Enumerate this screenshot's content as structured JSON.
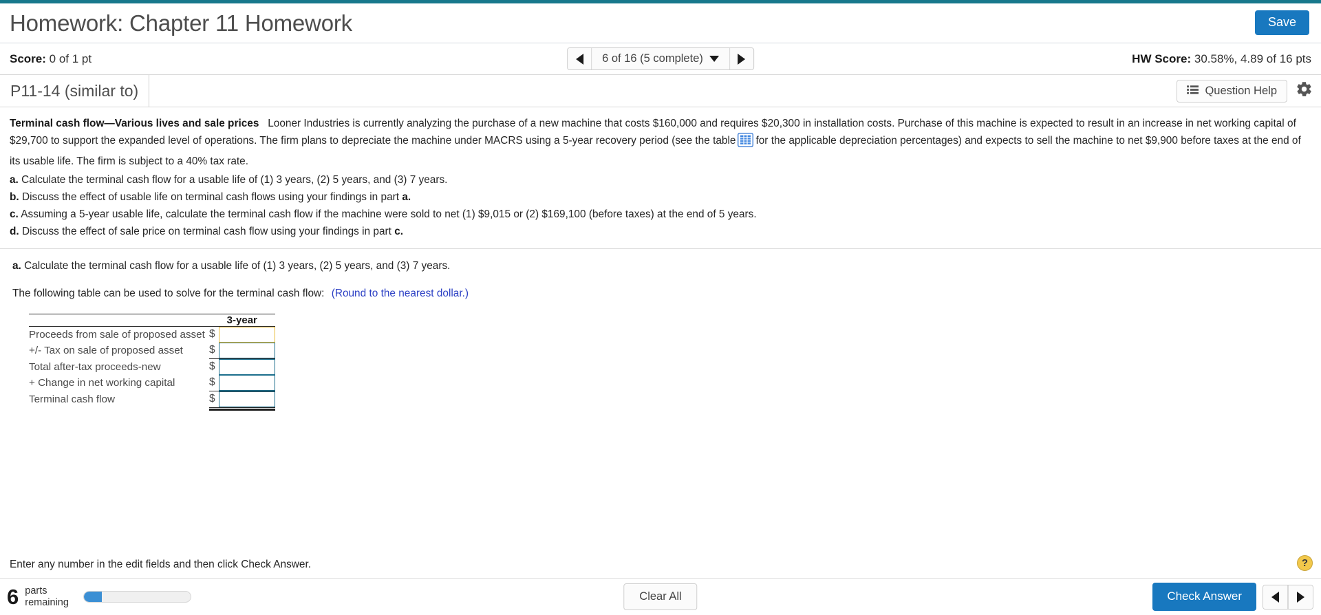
{
  "header": {
    "title": "Homework: Chapter 11 Homework",
    "save_label": "Save",
    "accent_color": "#17788c",
    "primary_button_color": "#1878bf"
  },
  "score_bar": {
    "score_label": "Score:",
    "score_value": "0 of 1 pt",
    "nav": {
      "position_text": "6 of 16 (5 complete)",
      "prev_icon": "triangle-left-icon",
      "next_icon": "triangle-right-icon",
      "dropdown_icon": "caret-down-icon"
    },
    "hw_score_label": "HW Score:",
    "hw_score_value": "30.58%, 4.89 of 16 pts"
  },
  "question_bar": {
    "question_id": "P11-14 (similar to)",
    "question_help_label": "Question Help",
    "question_help_icon": "list-icon",
    "settings_icon": "gear-icon"
  },
  "problem": {
    "title": "Terminal cash flow—Various lives and sale prices",
    "body_part_1": "Looner Industries is currently analyzing the purchase of a new machine that costs $160,000 and requires $20,300 in installation costs. Purchase of this machine is expected to result in an increase in net working capital of $29,700 to support the expanded level of operations. The firm plans to depreciate the machine under MACRS using a 5-year recovery period (see the table",
    "table_icon": "spreadsheet-table-icon",
    "body_part_2": "for the applicable depreciation percentages) and expects to sell the machine to net $9,900 before taxes at the end of its usable life. The firm is subject to a 40% tax rate.",
    "parts": [
      {
        "letter": "a.",
        "text": "Calculate the terminal cash flow for a usable life of  (1) 3 years, (2) 5 years, and (3) 7 years."
      },
      {
        "letter": "b.",
        "text": "Discuss the effect of usable life on terminal cash flows using your findings in part",
        "ref": "a."
      },
      {
        "letter": "c.",
        "text": " Assuming a 5-year usable life, calculate the terminal cash flow if the machine were sold to net (1) $9,015 or (2) $169,100 (before taxes) at the end of 5 years."
      },
      {
        "letter": "d.",
        "text": "Discuss the effect of sale price on terminal cash flow using your findings in part",
        "ref": "c."
      }
    ]
  },
  "subquestion": {
    "letter": "a.",
    "text": "Calculate the terminal cash flow for a usable life of  (1) 3 years, (2) 5 years, and (3) 7 years.",
    "prompt": "The following table can be used to solve for the terminal cash flow:",
    "round_note": "(Round to the nearest dollar.)",
    "round_note_color": "#2b3fc4"
  },
  "answer_table": {
    "column_header": "3-year",
    "currency_symbol": "$",
    "active_field_border": "#e8bb3c",
    "field_border": "#1c6e8c",
    "rows": [
      {
        "label": "Proceeds from sale of proposed asset",
        "value": "",
        "active": true
      },
      {
        "label": "+/- Tax on sale of proposed asset",
        "value": "",
        "active": false
      },
      {
        "label": "Total after-tax proceeds-new",
        "value": "",
        "active": false
      },
      {
        "label": "+ Change in net working capital",
        "value": "",
        "active": false
      },
      {
        "label": "Terminal cash flow",
        "value": "",
        "active": false
      }
    ]
  },
  "footer": {
    "message": "Enter any number in the edit fields and then click Check Answer.",
    "help_icon_label": "?",
    "parts_remaining_count": "6",
    "parts_remaining_line1": "parts",
    "parts_remaining_line2": "remaining",
    "progress_percent": 17,
    "clear_all_label": "Clear All",
    "check_answer_label": "Check Answer",
    "prev_icon": "triangle-left-icon",
    "next_icon": "triangle-right-icon"
  }
}
